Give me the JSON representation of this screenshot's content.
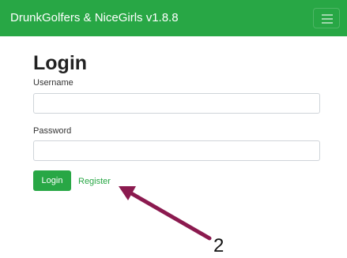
{
  "app": {
    "title": "DrunkGolfers & NiceGirls v1.8.8",
    "menu_icon": "hamburger-menu-icon",
    "accent_color": "#28a745"
  },
  "login_form": {
    "heading": "Login",
    "username_label": "Username",
    "username_value": "",
    "password_label": "Password",
    "password_value": "",
    "login_button_label": "Login",
    "register_link_label": "Register"
  },
  "annotation": {
    "label": "2",
    "color": "#8b1a4f"
  }
}
